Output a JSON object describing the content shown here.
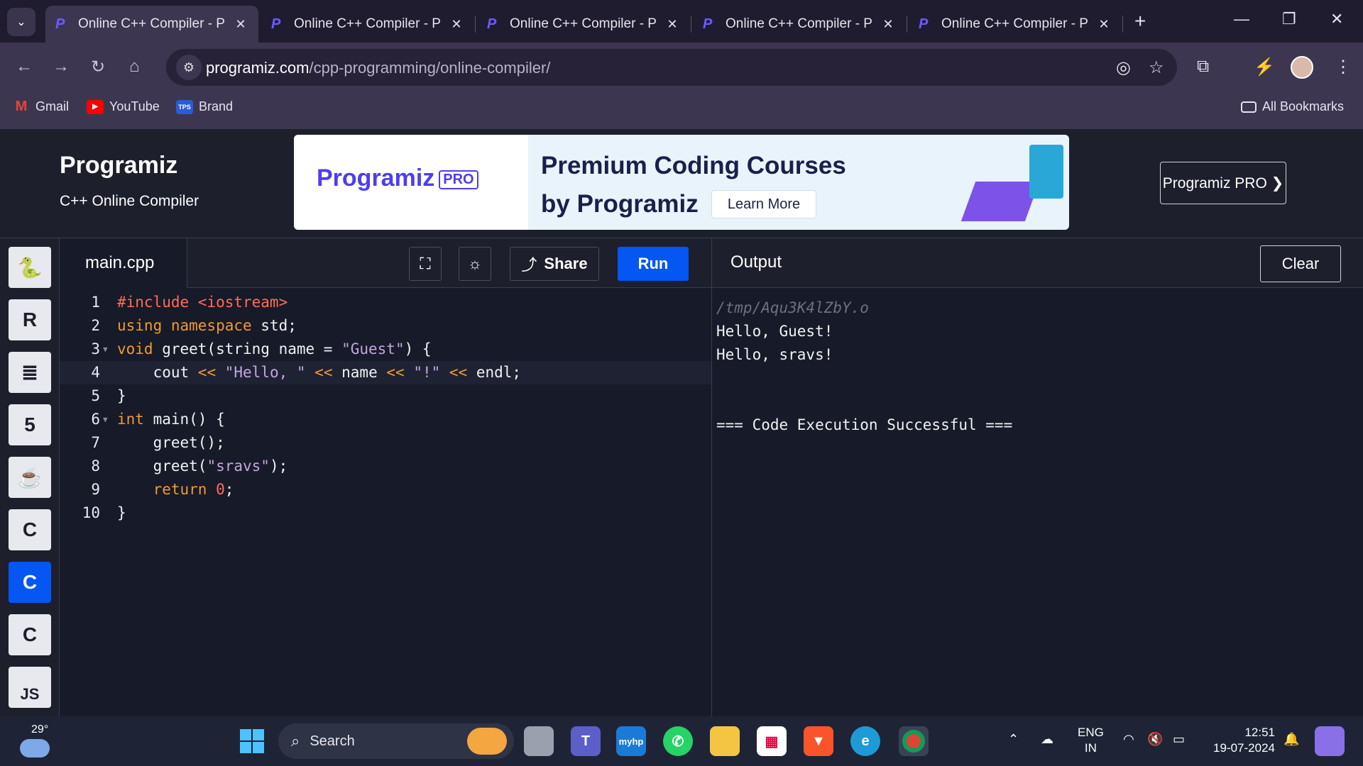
{
  "browser": {
    "tabs": [
      {
        "title": "Online C++ Compiler - P",
        "active": true
      },
      {
        "title": "Online C++ Compiler - P",
        "active": false
      },
      {
        "title": "Online C++ Compiler - P",
        "active": false
      },
      {
        "title": "Online C++ Compiler - P",
        "active": false
      },
      {
        "title": "Online C++ Compiler - P",
        "active": false
      }
    ],
    "url_domain": "programiz.com",
    "url_path": "/cpp-programming/online-compiler/",
    "bookmarks": [
      {
        "label": "Gmail",
        "icon": "gmail-icon"
      },
      {
        "label": "YouTube",
        "icon": "youtube-icon"
      },
      {
        "label": "Brand",
        "icon": "tps-icon",
        "icon_text": "TPS"
      }
    ],
    "all_bookmarks": "All Bookmarks"
  },
  "site": {
    "logo": "Programiz",
    "subtitle": "C++ Online Compiler",
    "banner": {
      "logo": "Programiz",
      "pro_badge": "PRO",
      "line1": "Premium Coding Courses",
      "line2": "by Programiz",
      "cta": "Learn More"
    },
    "pro_button": "Programiz PRO ❯"
  },
  "sidebar": {
    "languages": [
      {
        "name": "python-icon",
        "glyph": "🐍",
        "active": false
      },
      {
        "name": "r-icon",
        "glyph": "R",
        "active": false
      },
      {
        "name": "sql-icon",
        "glyph": "≣",
        "active": false
      },
      {
        "name": "html-icon",
        "glyph": "5",
        "active": false
      },
      {
        "name": "java-icon",
        "glyph": "☕",
        "active": false
      },
      {
        "name": "c-icon",
        "glyph": "C",
        "active": false
      },
      {
        "name": "cpp-icon",
        "glyph": "C",
        "active": true
      },
      {
        "name": "csharp-icon",
        "glyph": "C",
        "active": false
      },
      {
        "name": "js-icon",
        "glyph": "JS",
        "active": false
      }
    ]
  },
  "editor": {
    "filename": "main.cpp",
    "share_label": "Share",
    "run_label": "Run",
    "highlighted_line": 4,
    "lines": [
      {
        "n": "1",
        "fold": false,
        "tokens": [
          [
            "inc",
            "#include <iostream>"
          ]
        ]
      },
      {
        "n": "2",
        "fold": false,
        "tokens": [
          [
            "kw",
            "using namespace"
          ],
          [
            "",
            " std;"
          ]
        ]
      },
      {
        "n": "3",
        "fold": true,
        "tokens": [
          [
            "kw",
            "void"
          ],
          [
            "",
            " greet(string name = "
          ],
          [
            "str",
            "\"Guest\""
          ],
          [
            "",
            ") {"
          ]
        ]
      },
      {
        "n": "4",
        "fold": false,
        "tokens": [
          [
            "",
            "    cout "
          ],
          [
            "kw",
            "<<"
          ],
          [
            "",
            " "
          ],
          [
            "str",
            "\"Hello, \""
          ],
          [
            "",
            " "
          ],
          [
            "kw",
            "<<"
          ],
          [
            "",
            " name "
          ],
          [
            "kw",
            "<<"
          ],
          [
            "",
            " "
          ],
          [
            "str",
            "\"!\""
          ],
          [
            "",
            " "
          ],
          [
            "kw",
            "<<"
          ],
          [
            "",
            " endl;"
          ]
        ]
      },
      {
        "n": "5",
        "fold": false,
        "tokens": [
          [
            "",
            "}"
          ]
        ]
      },
      {
        "n": "6",
        "fold": true,
        "tokens": [
          [
            "kw",
            "int"
          ],
          [
            "",
            " main() {"
          ]
        ]
      },
      {
        "n": "7",
        "fold": false,
        "tokens": [
          [
            "",
            "    greet();"
          ]
        ]
      },
      {
        "n": "8",
        "fold": false,
        "tokens": [
          [
            "",
            "    greet("
          ],
          [
            "str",
            "\"sravs\""
          ],
          [
            "",
            ");"
          ]
        ]
      },
      {
        "n": "9",
        "fold": false,
        "tokens": [
          [
            "",
            "    "
          ],
          [
            "kw",
            "return"
          ],
          [
            "",
            " "
          ],
          [
            "num",
            "0"
          ],
          [
            "",
            ";"
          ]
        ]
      },
      {
        "n": "10",
        "fold": false,
        "tokens": [
          [
            "",
            "}"
          ]
        ]
      }
    ]
  },
  "output": {
    "title": "Output",
    "clear_label": "Clear",
    "lines": [
      {
        "text": "/tmp/Aqu3K4lZbY.o",
        "tmp": true
      },
      {
        "text": "Hello, Guest!",
        "tmp": false
      },
      {
        "text": "Hello, sravs!",
        "tmp": false
      },
      {
        "text": "",
        "tmp": false
      },
      {
        "text": "",
        "tmp": false
      },
      {
        "text": "=== Code Execution Successful ===",
        "tmp": false
      }
    ]
  },
  "taskbar": {
    "temperature": "29°",
    "search_placeholder": "Search",
    "language": "ENG",
    "region": "IN",
    "time": "12:51",
    "date": "19-07-2024"
  },
  "colors": {
    "accent": "#0556f3",
    "keyword": "#f09a36",
    "string": "#c3a6e0",
    "include": "#ff6c5a"
  }
}
